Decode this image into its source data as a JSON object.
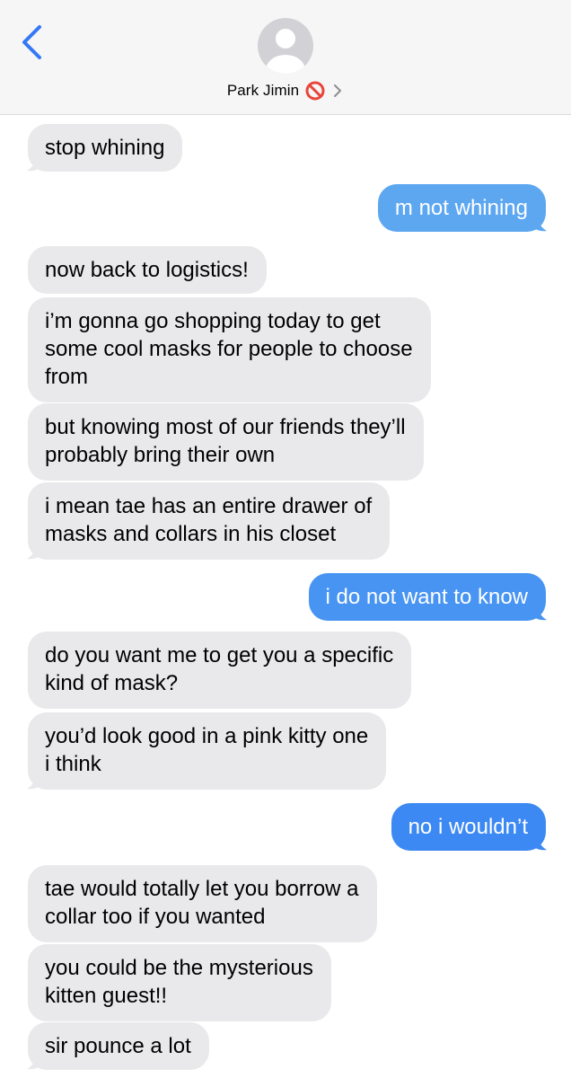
{
  "header": {
    "contact_name": "Park Jimin",
    "status_emoji_icon": "prohibited-icon",
    "back_icon": "chevron-left-icon",
    "detail_icon": "chevron-right-icon"
  },
  "colors": {
    "header_bg": "#f6f6f6",
    "incoming_bubble": "#e9e9eb",
    "outgoing_gradient_top": "#5fa9f0",
    "outgoing_gradient_bottom": "#2f7cf6",
    "ios_blue": "#3478f6"
  },
  "messages": [
    {
      "from": "them",
      "lines": [
        "stop whining"
      ]
    },
    {
      "from": "me",
      "lines": [
        "m not whining"
      ]
    },
    {
      "from": "them",
      "lines": [
        "now back to logistics!"
      ]
    },
    {
      "from": "them",
      "lines": [
        "i’m gonna go shopping today to get",
        "some cool masks for people to choose",
        "from"
      ]
    },
    {
      "from": "them",
      "lines": [
        "but knowing most of our friends they’ll",
        "probably bring their own"
      ]
    },
    {
      "from": "them",
      "lines": [
        "i mean tae has an entire drawer of",
        "masks and collars in his closet"
      ]
    },
    {
      "from": "me",
      "lines": [
        "i do not want to know"
      ]
    },
    {
      "from": "them",
      "lines": [
        "do you want me to get you a specific",
        "kind of mask?"
      ]
    },
    {
      "from": "them",
      "lines": [
        "you’d look good in a pink kitty one",
        "i think"
      ]
    },
    {
      "from": "me",
      "lines": [
        "no i wouldn’t"
      ]
    },
    {
      "from": "them",
      "lines": [
        "tae would totally let you borrow a",
        "collar too if you wanted"
      ]
    },
    {
      "from": "them",
      "lines": [
        "you could be the mysterious",
        "kitten guest!!"
      ]
    },
    {
      "from": "them",
      "lines": [
        "sir pounce a lot"
      ]
    }
  ]
}
